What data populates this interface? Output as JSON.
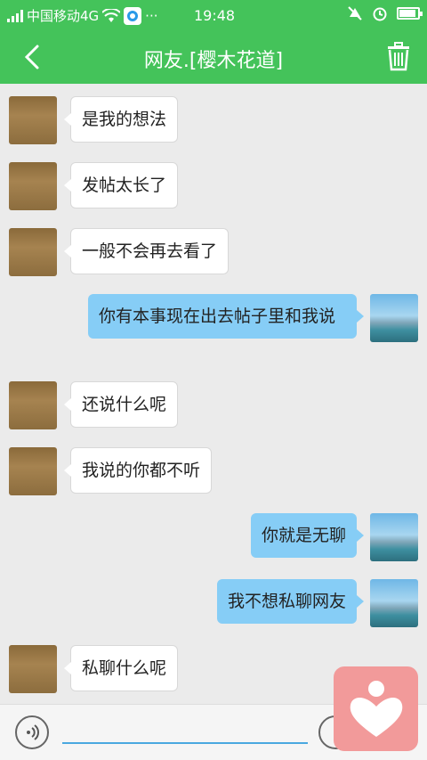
{
  "status": {
    "carrier": "中国移动4G",
    "time": "19:48",
    "more": "···"
  },
  "header": {
    "title": "网友.[樱木花道]"
  },
  "messages": [
    {
      "sender": "friend",
      "text": "是我的想法"
    },
    {
      "sender": "friend",
      "text": "发帖太长了"
    },
    {
      "sender": "friend",
      "text": "一般不会再去看了"
    },
    {
      "sender": "me",
      "text": "你有本事现在出去帖子里和我说"
    },
    {
      "sender": "friend",
      "text": "还说什么呢"
    },
    {
      "sender": "friend",
      "text": "我说的你都不听"
    },
    {
      "sender": "me",
      "text": "你就是无聊"
    },
    {
      "sender": "me",
      "text": "我不想私聊网友"
    },
    {
      "sender": "friend",
      "text": "私聊什么呢"
    }
  ],
  "input": {
    "value": "",
    "placeholder": ""
  },
  "colors": {
    "header_green": "#44c35a",
    "my_bubble": "#86cdf6",
    "floating_pink": "#f29a9a"
  },
  "icons": [
    "back-arrow-icon",
    "trash-icon",
    "voice-icon",
    "emoji-icon",
    "heart-person-icon"
  ]
}
